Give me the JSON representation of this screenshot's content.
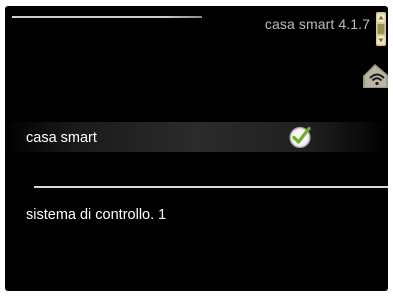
{
  "header": {
    "title": "casa smart 4.1.7"
  },
  "icons": {
    "scroll": "scroll-indicator-icon",
    "network": "wifi-house-icon",
    "check": "checkmark-icon"
  },
  "colors": {
    "background": "#000000",
    "text": "#ffffff",
    "title_text": "#bdbdbd",
    "check_green": "#6ab023",
    "icon_gold": "#c8b878"
  },
  "menu": {
    "items": [
      {
        "label": "casa smart",
        "checked": true
      },
      {
        "label": "sistema di controllo. 1"
      }
    ]
  }
}
